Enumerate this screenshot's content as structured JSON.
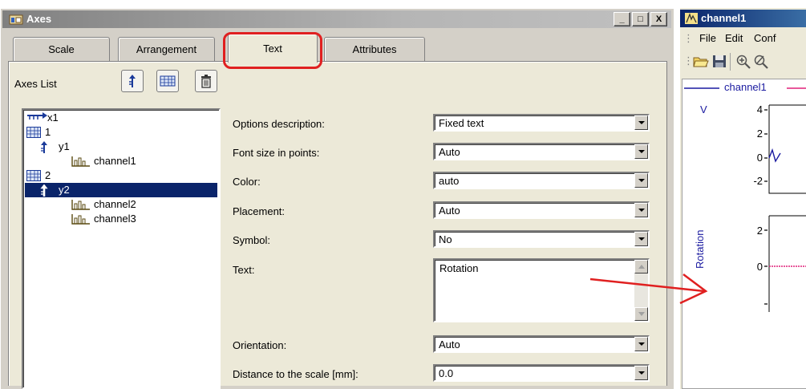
{
  "axes_dialog": {
    "title": "Axes",
    "window_buttons": [
      "_",
      "□",
      "X"
    ],
    "tabs": [
      {
        "label": "Scale"
      },
      {
        "label": "Arrangement"
      },
      {
        "label": "Text"
      },
      {
        "label": "Attributes"
      }
    ],
    "active_tab": "Text",
    "axes_list_label": "Axes List",
    "tree": [
      {
        "label": "x1",
        "icon": "x-axis-icon",
        "level": 0
      },
      {
        "label": "1",
        "icon": "grid-arrangement-icon",
        "level": 0
      },
      {
        "label": "y1",
        "icon": "y-axis-icon",
        "level": 1
      },
      {
        "label": "channel1",
        "icon": "channel-bars-icon",
        "level": 2
      },
      {
        "label": "2",
        "icon": "grid-arrangement-icon",
        "level": 0
      },
      {
        "label": "y2",
        "icon": "y-axis-icon",
        "level": 1,
        "selected": true
      },
      {
        "label": "channel2",
        "icon": "channel-bars-icon",
        "level": 2
      },
      {
        "label": "channel3",
        "icon": "channel-bars-icon",
        "level": 2
      }
    ],
    "form": {
      "options_description": {
        "label": "Options description:",
        "value": "Fixed text"
      },
      "font_size": {
        "label": "Font size in points:",
        "value": "Auto"
      },
      "color": {
        "label": "Color:",
        "value": "auto"
      },
      "placement": {
        "label": "Placement:",
        "value": "Auto"
      },
      "symbol": {
        "label": "Symbol:",
        "value": "No"
      },
      "text": {
        "label": "Text:",
        "value": "Rotation"
      },
      "orientation": {
        "label": "Orientation:",
        "value": "Auto"
      },
      "distance": {
        "label": "Distance to the scale [mm]:",
        "value": "0.0"
      }
    }
  },
  "channel_window": {
    "title": "channel1",
    "menu": [
      "File",
      "Edit",
      "Conf"
    ],
    "legend": "channel1",
    "y_unit": "V",
    "upper_ticks": [
      "4",
      "2",
      "0",
      "-2"
    ],
    "lower_ticks": [
      "2",
      "0"
    ],
    "axis_text": "Rotation"
  },
  "colors": {
    "highlight": "#e02020",
    "selection": "#0a246a",
    "axis_text": "#1a1aa0"
  }
}
